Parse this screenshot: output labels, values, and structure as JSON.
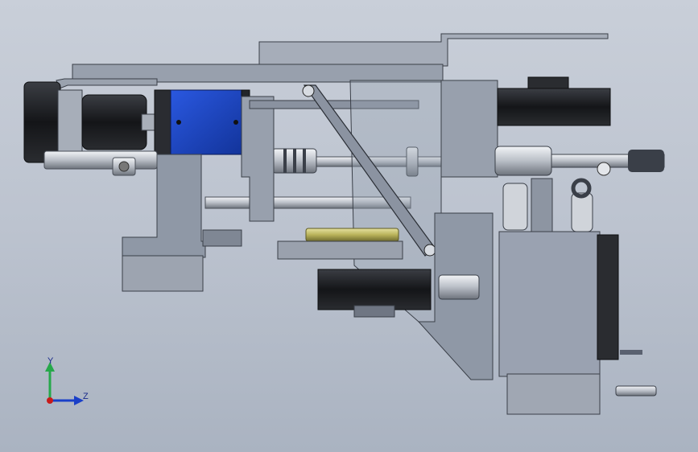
{
  "viewport": {
    "background_top": "#c9cfd9",
    "background_bottom": "#aab3c1"
  },
  "model": {
    "parts": [
      "stepper-motor-left",
      "blue-gearbox",
      "coupling",
      "threaded-shaft",
      "linear-guide-rod",
      "diagonal-link-arm",
      "brass-spring-cylinder",
      "vertical-guide-rail",
      "right-actuator-block",
      "pneumatic-fittings"
    ],
    "colors": {
      "frame": "#8f98a6",
      "frame_edge": "#3a3f48",
      "motor_black": "#1b1d20",
      "gearbox_blue": "#1c44c2",
      "shaft_steel": "#d2d6dc",
      "brass": "#b9b35a",
      "block_gray": "#9aa2b1"
    }
  },
  "triad": {
    "y_label": "Y",
    "z_label": "Z",
    "y_color": "#26a84a",
    "z_color": "#1a3fc8",
    "x_color": "#c81a1a"
  }
}
